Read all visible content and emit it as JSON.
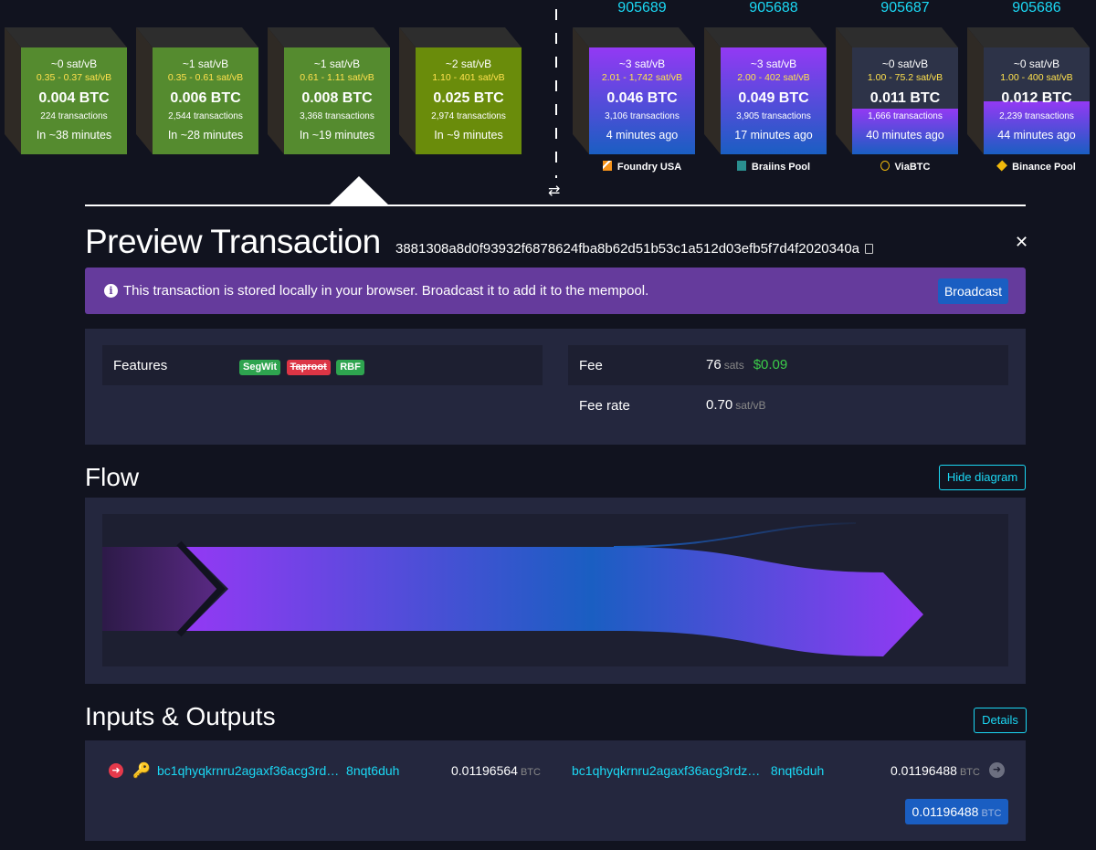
{
  "pending_blocks": [
    {
      "fee": "~0 sat/vB",
      "range": "0.35 - 0.37 sat/vB",
      "size": "0.004 BTC",
      "txs": "224 transactions",
      "time": "In ~38 minutes",
      "color": "#558b2f"
    },
    {
      "fee": "~1 sat/vB",
      "range": "0.35 - 0.61 sat/vB",
      "size": "0.006 BTC",
      "txs": "2,544 transactions",
      "time": "In ~28 minutes",
      "color": "#558b2f"
    },
    {
      "fee": "~1 sat/vB",
      "range": "0.61 - 1.11 sat/vB",
      "size": "0.008 BTC",
      "txs": "3,368 transactions",
      "time": "In ~19 minutes",
      "color": "#558b2f"
    },
    {
      "fee": "~2 sat/vB",
      "range": "1.10 - 401 sat/vB",
      "size": "0.025 BTC",
      "txs": "2,974 transactions",
      "time": "In ~9 minutes",
      "color": "#6a8c0b"
    }
  ],
  "mined_blocks": [
    {
      "height": "905689",
      "fee": "~3 sat/vB",
      "range": "2.01 - 1,742 sat/vB",
      "size": "0.046 BTC",
      "txs": "3,106 transactions",
      "time": "4 minutes ago",
      "pool": "Foundry USA",
      "pool_icon": "foundry-icon",
      "fill_fraction": 1.0
    },
    {
      "height": "905688",
      "fee": "~3 sat/vB",
      "range": "2.00 - 402 sat/vB",
      "size": "0.049 BTC",
      "txs": "3,905 transactions",
      "time": "17 minutes ago",
      "pool": "Braiins Pool",
      "pool_icon": "braiins-icon",
      "fill_fraction": 1.0
    },
    {
      "height": "905687",
      "fee": "~0 sat/vB",
      "range": "1.00 - 75.2 sat/vB",
      "size": "0.011 BTC",
      "txs": "1,666 transactions",
      "time": "40 minutes ago",
      "pool": "ViaBTC",
      "pool_icon": "viabtc-icon",
      "fill_fraction": 0.43
    },
    {
      "height": "905686",
      "fee": "~0 sat/vB",
      "range": "1.00 - 400 sat/vB",
      "size": "0.012 BTC",
      "txs": "2,239 transactions",
      "time": "44 minutes ago",
      "pool": "Binance Pool",
      "pool_icon": "binance-icon",
      "fill_fraction": 0.5
    }
  ],
  "colors": {
    "mined_gradient_top": "#9339f4",
    "mined_gradient_bottom": "#1a5ec2",
    "accent_cyan": "#1bd8f4",
    "alert_purple": "#653b9c",
    "fee_green": "#3bcc49"
  },
  "header": {
    "title": "Preview Transaction",
    "txid": "3881308a8d0f93932f6878624fba8b62d51b53c1a512d03efb5f7d4f2020340a"
  },
  "alert": {
    "text": "This transaction is stored locally in your browser. Broadcast it to add it to the mempool.",
    "button": "Broadcast"
  },
  "details": {
    "features_label": "Features",
    "features": [
      "SegWit",
      "Taproot",
      "RBF"
    ],
    "fee_label": "Fee",
    "fee_value": "76",
    "fee_unit": "sats",
    "fee_usd": "$0.09",
    "fee_rate_label": "Fee rate",
    "fee_rate_value": "0.70",
    "fee_rate_unit": "sat/vB"
  },
  "flow": {
    "title": "Flow",
    "button": "Hide diagram"
  },
  "io": {
    "title": "Inputs & Outputs",
    "button": "Details",
    "input_address": "bc1qhyqkrnru2agaxf36acg3rd…",
    "input_address_end": "8nqt6duh",
    "input_amount": "0.01196564",
    "output_address": "bc1qhyqkrnru2agaxf36acg3rdz…",
    "output_address_end": "8nqt6duh",
    "output_amount": "0.01196488",
    "total": "0.01196488",
    "unit": "BTC"
  }
}
